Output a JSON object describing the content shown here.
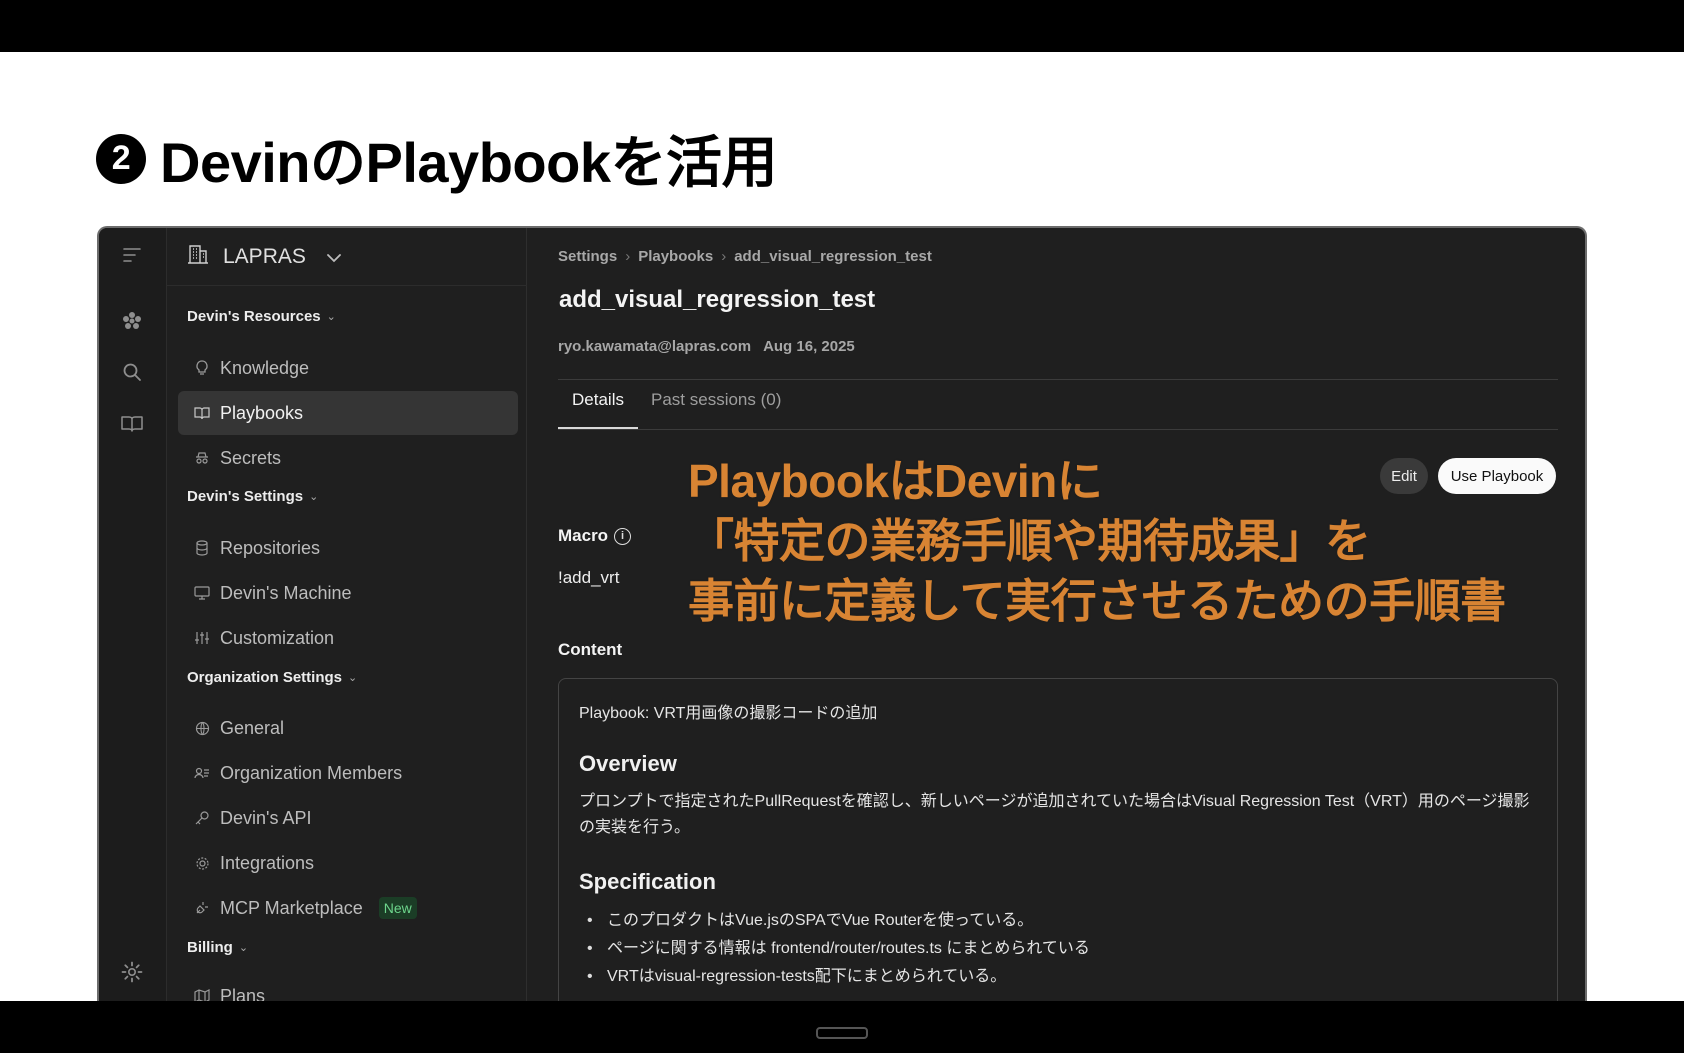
{
  "slide": {
    "title_number": "2",
    "title": "DevinのPlaybookを活用"
  },
  "overlay": {
    "line1": "PlaybookはDevinに",
    "line2": "「特定の業務手順や期待成果」を",
    "line3": "事前に定義して実行させるための手順書",
    "color": "#d88433"
  },
  "sidebar": {
    "org_name": "LAPRAS",
    "sections": {
      "resources": "Devin's Resources",
      "settings": "Devin's Settings",
      "organization": "Organization Settings",
      "billing": "Billing"
    },
    "items": {
      "knowledge": "Knowledge",
      "playbooks": "Playbooks",
      "secrets": "Secrets",
      "repositories": "Repositories",
      "machine": "Devin's Machine",
      "customization": "Customization",
      "general": "General",
      "members": "Organization Members",
      "api": "Devin's API",
      "integrations": "Integrations",
      "mcp": "MCP Marketplace",
      "mcp_badge": "New",
      "plans": "Plans"
    }
  },
  "main": {
    "breadcrumb": [
      "Settings",
      "Playbooks",
      "add_visual_regression_test"
    ],
    "title": "add_visual_regression_test",
    "author": "ryo.kawamata@lapras.com",
    "date": "Aug 16, 2025",
    "tabs": [
      "Details",
      "Past sessions (0)"
    ],
    "edit_label": "Edit",
    "use_label": "Use Playbook",
    "macro_label": "Macro",
    "macro_value": "!add_vrt",
    "content_label": "Content",
    "content": {
      "first_line": "Playbook: VRT用画像の撮影コードの追加",
      "overview_heading": "Overview",
      "overview_text": "プロンプトで指定されたPullRequestを確認し、新しいページが追加されていた場合はVisual Regression Test（VRT）用のページ撮影の実装を行う。",
      "spec_heading": "Specification",
      "spec_items": [
        "このプロダクトはVue.jsのSPAでVue Routerを使っている。",
        "ページに関する情報は frontend/router/routes.ts にまとめられている",
        "VRTはvisual-regression-tests配下にまとめられている。"
      ]
    }
  }
}
